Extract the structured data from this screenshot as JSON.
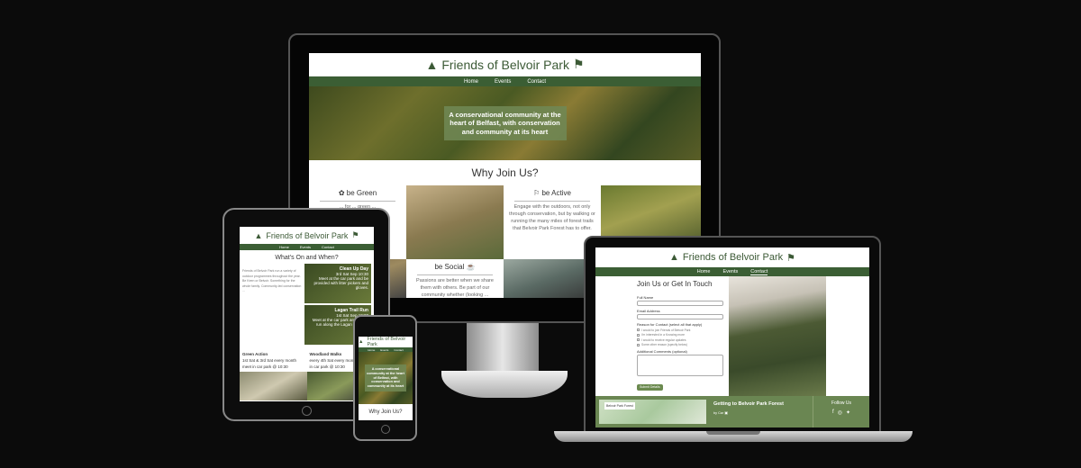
{
  "brand": {
    "name": "Friends of Belvoir Park",
    "green": "#3b5e34",
    "accent": "#6b8a4f"
  },
  "nav": {
    "home": "Home",
    "events": "Events",
    "contact": "Contact"
  },
  "hero": {
    "tagline": "A conservational community at the heart of Belfast, with conservation and community at its heart"
  },
  "why": {
    "title": "Why Join Us?",
    "green_title": "be Green",
    "green_text": "... for ... green ...",
    "active_title": "be Active",
    "active_text": "Engage with the outdoors, not only through conservation, but by walking or running the many miles of forest trails that Belvoir Park Forest has to offer.",
    "social_title": "be Social",
    "social_text": "Passions are better when we share them with others. Be part of our community whether (looking ..."
  },
  "events_page": {
    "title": "What's On and When?",
    "intro": "Friends of Belvoir Park run a variety of outdoor programmes throughout the year. Be Keen or Belvoir. Something for the whole family. Community-led conservation ...",
    "event1_title": "Clean Up Day",
    "event1_date": "3rd Sat Sep 10:30",
    "event1_text": "Meet at the car park and be provided with litter pickers and gloves.",
    "event2_title": "Lagan Trail Run",
    "event2_date": "1st Sat Sep 10:00",
    "event2_text": "Meet at the car park and take a run along the Lagan towpath.",
    "footer1_title": "Green Action",
    "footer1_text": "1st Sat & 3rd Sat every month meet in car park @ 10:30",
    "footer2_title": "Woodland Walks",
    "footer2_text": "every 4th Sat every month meet in car park @ 10:30"
  },
  "contact_page": {
    "title": "Join Us or Get In Touch",
    "full_name": "Full Name",
    "email": "Email Address",
    "reason": "Reason for Contact (select all that apply)",
    "opt1": "I would to join Friends of Belvoir Park",
    "opt2": "I'm interested in a Knowing more",
    "opt3": "I would to receive regular updates",
    "opt4": "Some other reason (specify below)",
    "comments": "Additional Comments (optional)",
    "submit": "Submit Details",
    "map_label": "Belvoir Park Forest",
    "getting_title": "Getting to Belvoir Park Forest",
    "getting_sub": "by Car",
    "follow": "Follow Us"
  },
  "icons": [
    "tree-icon",
    "signpost-icon",
    "seedling-icon",
    "walking-icon",
    "coffee-icon",
    "facebook-icon",
    "instagram-icon",
    "twitter-icon"
  ]
}
